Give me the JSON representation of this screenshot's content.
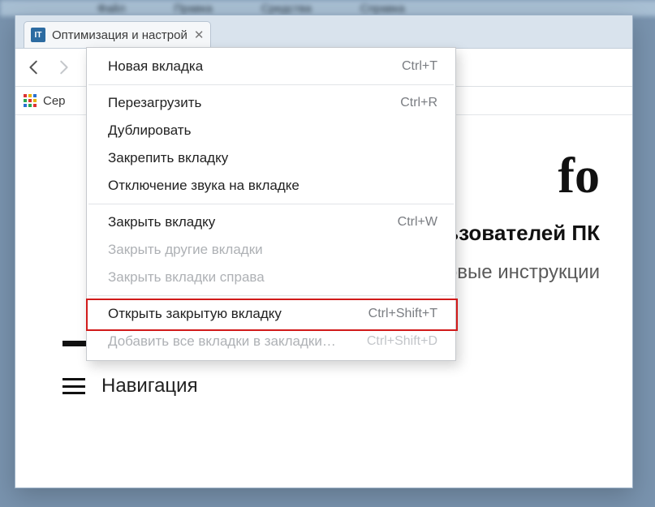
{
  "bg_menu": [
    "Файл",
    "Правка",
    "Средства",
    "Справка"
  ],
  "tab": {
    "favicon_text": "IT",
    "title": "Оптимизация и настрой"
  },
  "bookmarks": {
    "apps_label": "Сер"
  },
  "page": {
    "logo_fragment": "fo",
    "sub1_fragment": "ьзователей ПК",
    "sub2_fragment": "овые инструкции",
    "nav_label": "Навигация"
  },
  "context_menu": {
    "items": [
      {
        "label": "Новая вкладка",
        "shortcut": "Ctrl+T",
        "disabled": false
      },
      {
        "sep": true
      },
      {
        "label": "Перезагрузить",
        "shortcut": "Ctrl+R",
        "disabled": false
      },
      {
        "label": "Дублировать",
        "shortcut": "",
        "disabled": false
      },
      {
        "label": "Закрепить вкладку",
        "shortcut": "",
        "disabled": false
      },
      {
        "label": "Отключение звука на вкладке",
        "shortcut": "",
        "disabled": false
      },
      {
        "sep": true
      },
      {
        "label": "Закрыть вкладку",
        "shortcut": "Ctrl+W",
        "disabled": false
      },
      {
        "label": "Закрыть другие вкладки",
        "shortcut": "",
        "disabled": true
      },
      {
        "label": "Закрыть вкладки справа",
        "shortcut": "",
        "disabled": true
      },
      {
        "sep": true
      },
      {
        "label": "Открыть закрытую вкладку",
        "shortcut": "Ctrl+Shift+T",
        "disabled": false,
        "highlight": true
      },
      {
        "label": "Добавить все вкладки в закладки…",
        "shortcut": "Ctrl+Shift+D",
        "disabled": true
      }
    ]
  }
}
